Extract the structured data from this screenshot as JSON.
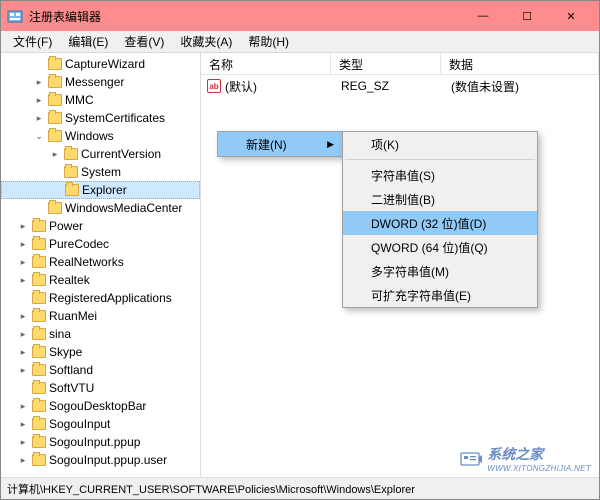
{
  "window": {
    "title": "注册表编辑器"
  },
  "menu": {
    "file": "文件(F)",
    "edit": "编辑(E)",
    "view": "查看(V)",
    "favorites": "收藏夹(A)",
    "help": "帮助(H)"
  },
  "tree": {
    "items": [
      {
        "label": "CaptureWizard",
        "indent": 2,
        "exp": ""
      },
      {
        "label": "Messenger",
        "indent": 2,
        "exp": "▸"
      },
      {
        "label": "MMC",
        "indent": 2,
        "exp": "▸"
      },
      {
        "label": "SystemCertificates",
        "indent": 2,
        "exp": "▸"
      },
      {
        "label": "Windows",
        "indent": 2,
        "exp": "⌄"
      },
      {
        "label": "CurrentVersion",
        "indent": 3,
        "exp": "▸"
      },
      {
        "label": "System",
        "indent": 3,
        "exp": ""
      },
      {
        "label": "Explorer",
        "indent": 3,
        "exp": "",
        "selected": true
      },
      {
        "label": "WindowsMediaCenter",
        "indent": 2,
        "exp": ""
      },
      {
        "label": "Power",
        "indent": 1,
        "exp": "▸"
      },
      {
        "label": "PureCodec",
        "indent": 1,
        "exp": "▸"
      },
      {
        "label": "RealNetworks",
        "indent": 1,
        "exp": "▸"
      },
      {
        "label": "Realtek",
        "indent": 1,
        "exp": "▸"
      },
      {
        "label": "RegisteredApplications",
        "indent": 1,
        "exp": ""
      },
      {
        "label": "RuanMei",
        "indent": 1,
        "exp": "▸"
      },
      {
        "label": "sina",
        "indent": 1,
        "exp": "▸"
      },
      {
        "label": "Skype",
        "indent": 1,
        "exp": "▸"
      },
      {
        "label": "Softland",
        "indent": 1,
        "exp": "▸"
      },
      {
        "label": "SoftVTU",
        "indent": 1,
        "exp": ""
      },
      {
        "label": "SogouDesktopBar",
        "indent": 1,
        "exp": "▸"
      },
      {
        "label": "SogouInput",
        "indent": 1,
        "exp": "▸"
      },
      {
        "label": "SogouInput.ppup",
        "indent": 1,
        "exp": "▸"
      },
      {
        "label": "SogouInput.ppup.user",
        "indent": 1,
        "exp": "▸"
      }
    ]
  },
  "columns": {
    "name": "名称",
    "type": "类型",
    "data": "数据"
  },
  "rows": [
    {
      "name": "(默认)",
      "type": "REG_SZ",
      "data": "(数值未设置)"
    }
  ],
  "context_menu1": {
    "new": "新建(N)"
  },
  "context_menu2": {
    "key": "项(K)",
    "string": "字符串值(S)",
    "binary": "二进制值(B)",
    "dword": "DWORD (32 位)值(D)",
    "qword": "QWORD (64 位)值(Q)",
    "multi": "多字符串值(M)",
    "expand": "可扩充字符串值(E)"
  },
  "statusbar": {
    "path": "计算机\\HKEY_CURRENT_USER\\SOFTWARE\\Policies\\Microsoft\\Windows\\Explorer"
  },
  "watermark": {
    "text": "系统之家",
    "url": "WWW.XITONGZHIJIA.NET"
  }
}
